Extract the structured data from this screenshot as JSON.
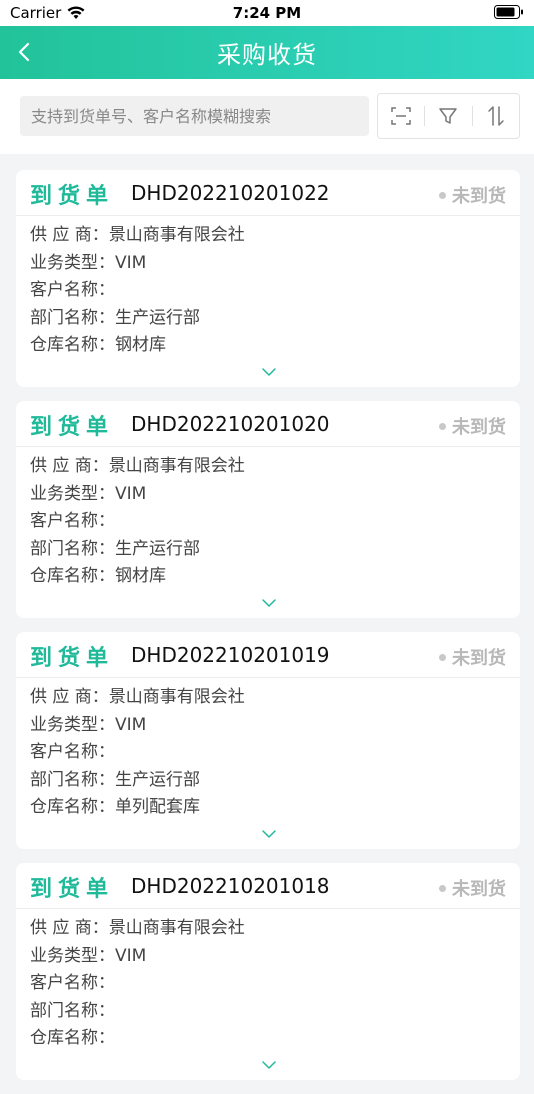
{
  "status_bar": {
    "carrier": "Carrier",
    "time": "7:24 PM"
  },
  "nav": {
    "title": "采购收货"
  },
  "search": {
    "placeholder": "支持到货单号、客户名称模糊搜索"
  },
  "labels": {
    "doc_type": "到货单",
    "supplier": "供 应 商：",
    "business_type": "业务类型：",
    "customer": "客户名称：",
    "department": "部门名称：",
    "warehouse": "仓库名称："
  },
  "orders": [
    {
      "no": "DHD202210201022",
      "status": "未到货",
      "supplier": "景山商事有限会社",
      "business_type": "VIM",
      "customer": "",
      "department": "生产运行部",
      "warehouse": "钢材库"
    },
    {
      "no": "DHD202210201020",
      "status": "未到货",
      "supplier": "景山商事有限会社",
      "business_type": "VIM",
      "customer": "",
      "department": "生产运行部",
      "warehouse": "钢材库"
    },
    {
      "no": "DHD202210201019",
      "status": "未到货",
      "supplier": "景山商事有限会社",
      "business_type": "VIM",
      "customer": "",
      "department": "生产运行部",
      "warehouse": "单列配套库"
    },
    {
      "no": "DHD202210201018",
      "status": "未到货",
      "supplier": "景山商事有限会社",
      "business_type": "VIM",
      "customer": "",
      "department": "",
      "warehouse": ""
    }
  ],
  "colors": {
    "accent": "#20b99a",
    "nav_start": "#22c39a",
    "nav_end": "#31d6c4",
    "status_pending": "#b8b8b8"
  }
}
